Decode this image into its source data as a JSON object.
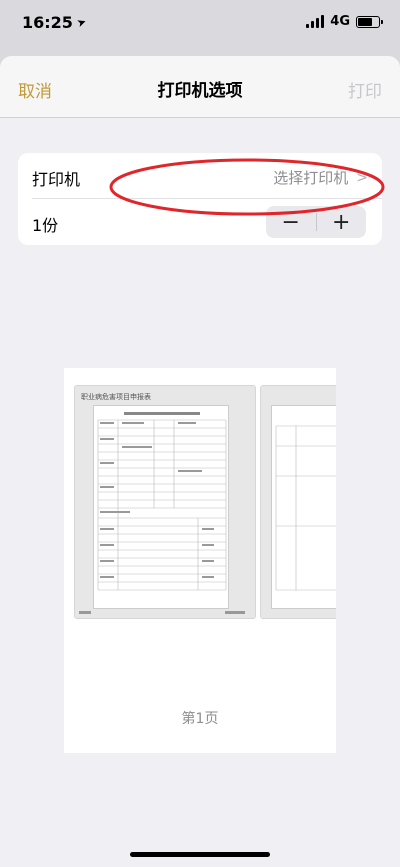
{
  "status_bar": {
    "time": "16:25",
    "network": "4G"
  },
  "nav": {
    "cancel_label": "取消",
    "title": "打印机选项",
    "print_label": "打印"
  },
  "options": {
    "printer_label": "打印机",
    "printer_value": "选择打印机",
    "copies_label": "1份",
    "minus_label": "−",
    "plus_label": "+"
  },
  "preview": {
    "document_title": "职业病危害项目申报表",
    "page_label": "第1页"
  },
  "colors": {
    "accent": "#c09a3a",
    "disabled": "#c8c8cc",
    "secondary_text": "#8e8e93",
    "annotation": "#e0262a"
  },
  "icons": {
    "location": "location-arrow-icon",
    "chevron": "chevron-right-icon"
  }
}
